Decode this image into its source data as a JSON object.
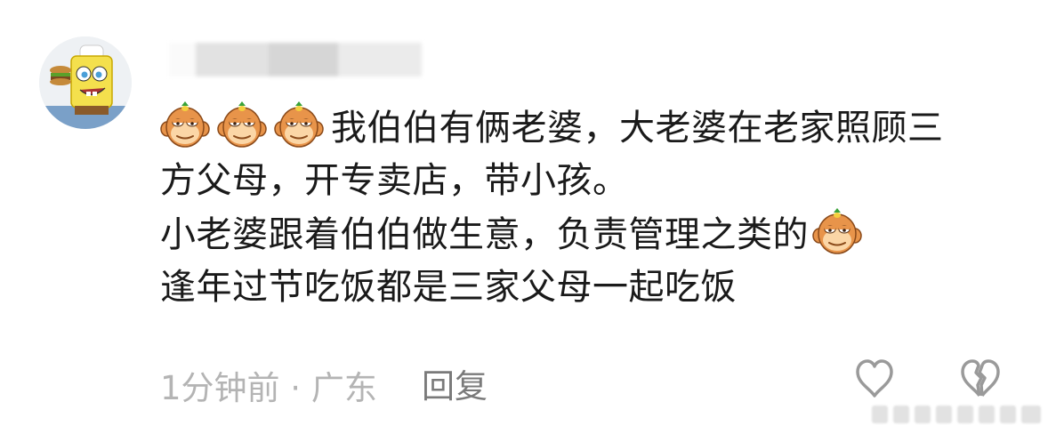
{
  "comment": {
    "avatar_icon": "spongebob-chef-avatar",
    "username": "",
    "emoji_icon": "monkey-face-emoji",
    "lines": {
      "l1": "我伯伯有俩老婆，大老婆在老家照顾三",
      "l2": "方父母，开专卖店，带小孩。",
      "l3": "小老婆跟着伯伯做生意，负责管理之类的",
      "l4": "逢年过节吃饭都是三家父母一起吃饭"
    },
    "time_location": "1分钟前 · 广东",
    "reply_label": "回复"
  },
  "actions": {
    "like_icon": "heart-outline-icon",
    "dislike_icon": "broken-heart-icon"
  },
  "colors": {
    "text": "#1a1a1a",
    "meta": "#b4b4b4",
    "reply": "#7a7a7a",
    "emoji_face": "#f6b26b"
  }
}
